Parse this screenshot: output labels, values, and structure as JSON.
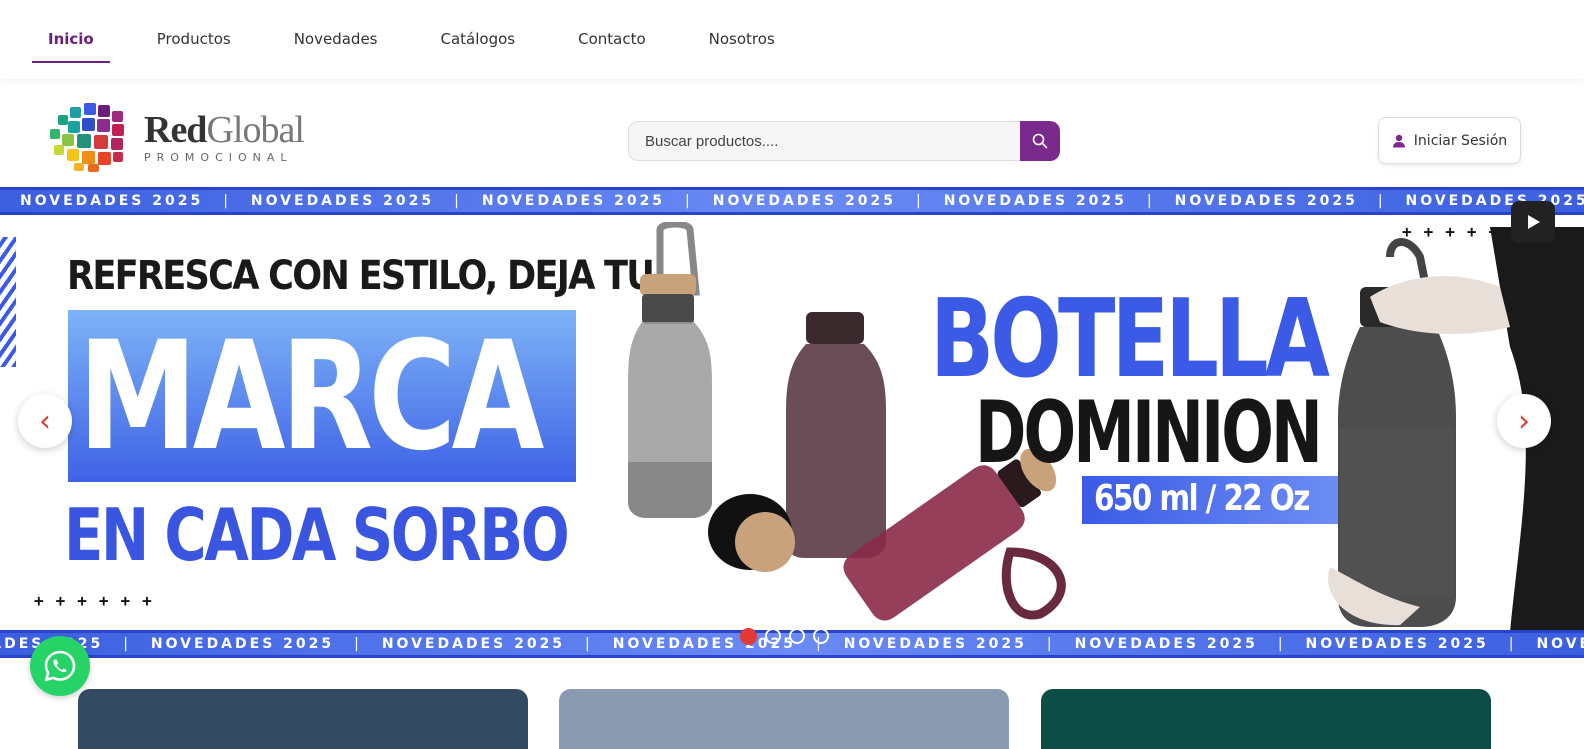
{
  "nav": {
    "items": [
      {
        "label": "Inicio",
        "active": true
      },
      {
        "label": "Productos",
        "active": false
      },
      {
        "label": "Novedades",
        "active": false
      },
      {
        "label": "Catálogos",
        "active": false
      },
      {
        "label": "Contacto",
        "active": false
      },
      {
        "label": "Nosotros",
        "active": false
      }
    ]
  },
  "header": {
    "logo_brand_1": "Red",
    "logo_brand_2": "Global",
    "logo_sub": "PROMOCIONAL",
    "search_placeholder": "Buscar productos....",
    "search_icon": "search-icon",
    "login_label": "Iniciar Sesión",
    "login_icon": "user-icon"
  },
  "banner": {
    "ticker_text": "NOVEDADES 2025",
    "headline_top": "REFRESCA CON ESTILO, DEJA TU",
    "headline_big": "MARCA",
    "headline_bottom": "EN CADA SORBO",
    "product_name_1": "BOTELLA",
    "product_name_2": "DOMINION",
    "product_volume": "650 ml / 22 Oz",
    "slide_count": 4,
    "active_slide": 1,
    "prev_label": "‹",
    "next_label": "›"
  },
  "colors": {
    "brand_purple": "#7a2a8c",
    "banner_blue": "#3b5be6",
    "whatsapp_green": "#25d366",
    "accent_red": "#e53935"
  }
}
